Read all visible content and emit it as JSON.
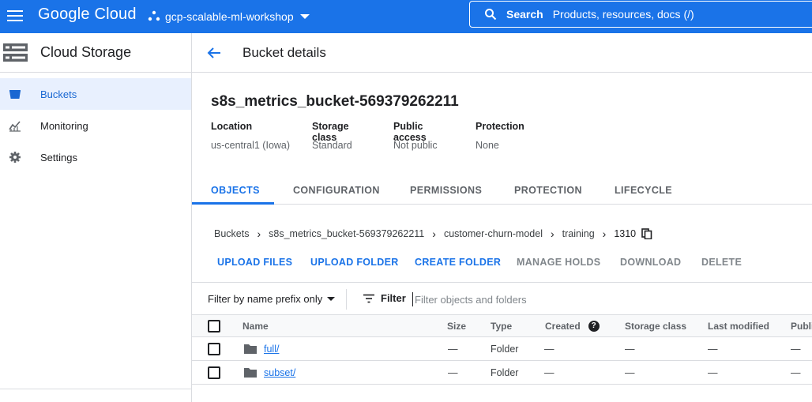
{
  "topbar": {
    "brand": "Google Cloud",
    "project": "gcp-scalable-ml-workshop",
    "search_label": "Search",
    "search_placeholder": "Products, resources, docs (/)"
  },
  "sidebar": {
    "title": "Cloud Storage",
    "items": [
      {
        "label": "Buckets",
        "icon": "bucket-icon"
      },
      {
        "label": "Monitoring",
        "icon": "monitoring-icon"
      },
      {
        "label": "Settings",
        "icon": "gear-icon"
      }
    ]
  },
  "header": {
    "title": "Bucket details"
  },
  "bucket": {
    "name": "s8s_metrics_bucket-569379262211",
    "props": [
      {
        "label": "Location",
        "value": "us-central1 (Iowa)"
      },
      {
        "label": "Storage class",
        "value": "Standard"
      },
      {
        "label": "Public access",
        "value": "Not public"
      },
      {
        "label": "Protection",
        "value": "None"
      }
    ]
  },
  "tabs": [
    "OBJECTS",
    "CONFIGURATION",
    "PERMISSIONS",
    "PROTECTION",
    "LIFECYCLE"
  ],
  "breadcrumb": [
    "Buckets",
    "s8s_metrics_bucket-569379262211",
    "customer-churn-model",
    "training",
    "1310"
  ],
  "actions": [
    "UPLOAD FILES",
    "UPLOAD FOLDER",
    "CREATE FOLDER",
    "MANAGE HOLDS",
    "DOWNLOAD",
    "DELETE"
  ],
  "filter": {
    "prefix_label": "Filter by name prefix only",
    "filter_label": "Filter",
    "placeholder": "Filter objects and folders"
  },
  "table": {
    "columns": [
      "Name",
      "Size",
      "Type",
      "Created",
      "Storage class",
      "Last modified",
      "Publi"
    ],
    "rows": [
      {
        "name": "full/",
        "size": "—",
        "type": "Folder",
        "created": "—",
        "storage_class": "—",
        "last_modified": "—",
        "public": "—"
      },
      {
        "name": "subset/",
        "size": "—",
        "type": "Folder",
        "created": "—",
        "storage_class": "—",
        "last_modified": "—",
        "public": "—"
      }
    ]
  },
  "colors": {
    "accent": "#1a73e8",
    "active_bg": "#e8f0fe"
  }
}
